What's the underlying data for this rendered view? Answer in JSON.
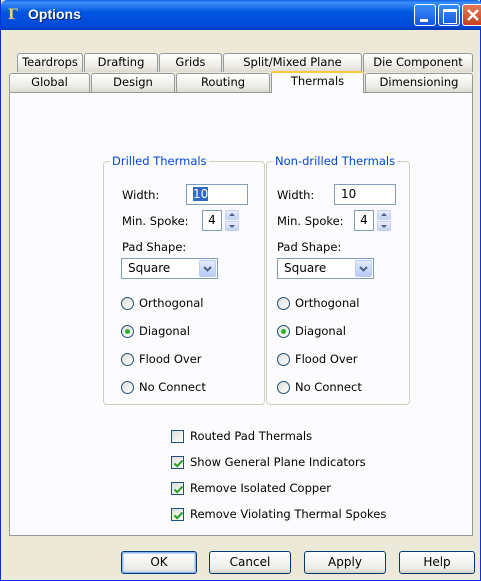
{
  "window": {
    "title": "Options"
  },
  "tabs_back": [
    "Teardrops",
    "Drafting",
    "Grids",
    "Split/Mixed Plane",
    "Die Component"
  ],
  "tabs_front": [
    "Global",
    "Design",
    "Routing",
    "Thermals",
    "Dimensioning"
  ],
  "active_tab": "Thermals",
  "drilled": {
    "title": "Drilled Thermals",
    "width_label": "Width:",
    "width_value": "10",
    "spoke_label": "Min. Spoke:",
    "spoke_value": "4",
    "pad_shape_label": "Pad Shape:",
    "pad_shape_value": "Square",
    "options": [
      "Orthogonal",
      "Diagonal",
      "Flood Over",
      "No Connect"
    ],
    "selected": "Diagonal"
  },
  "nondrilled": {
    "title": "Non-drilled Thermals",
    "width_label": "Width:",
    "width_value": "10",
    "spoke_label": "Min. Spoke:",
    "spoke_value": "4",
    "pad_shape_label": "Pad Shape:",
    "pad_shape_value": "Square",
    "options": [
      "Orthogonal",
      "Diagonal",
      "Flood Over",
      "No Connect"
    ],
    "selected": "Diagonal"
  },
  "checkboxes": [
    {
      "label": "Routed Pad Thermals",
      "checked": false
    },
    {
      "label": "Show General Plane Indicators",
      "checked": true
    },
    {
      "label": "Remove Isolated Copper",
      "checked": true
    },
    {
      "label": "Remove Violating Thermal Spokes",
      "checked": true
    }
  ],
  "buttons": {
    "ok": "OK",
    "cancel": "Cancel",
    "apply": "Apply",
    "help": "Help"
  },
  "colors": {
    "titlebar": "#0054e3",
    "group_title": "#0046d5",
    "active_tab_accent": "#ffc83c",
    "radio_dot": "#2bb12b"
  }
}
